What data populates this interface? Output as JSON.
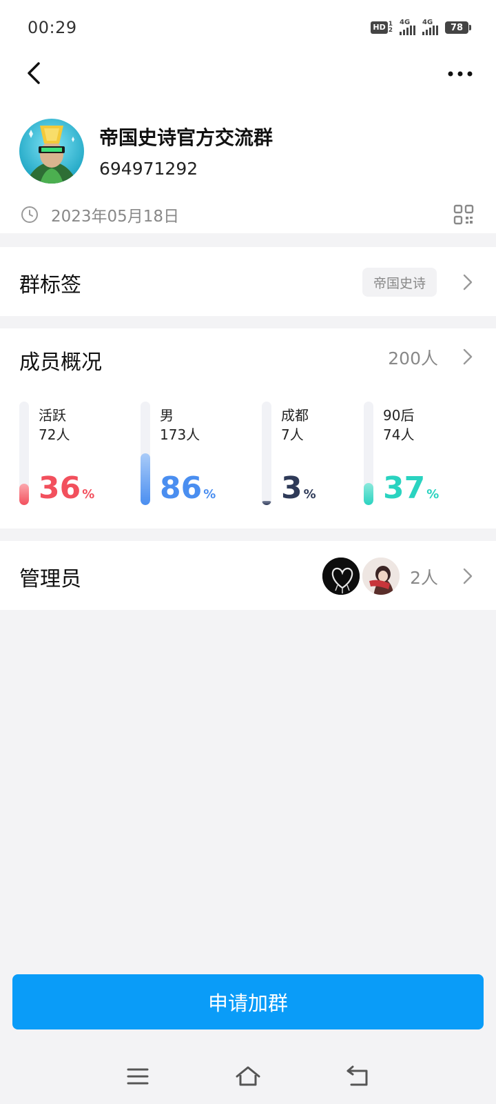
{
  "status_bar": {
    "time": "00:29",
    "hd": "HD",
    "hd_sub_top": "1",
    "hd_sub_bottom": "2",
    "network1": "4G",
    "network2": "4G",
    "battery": "78"
  },
  "header": {
    "back_icon": "chevron-left-icon",
    "more_icon": "more-horizontal-icon"
  },
  "group": {
    "name": "帝国史诗官方交流群",
    "id": "694971292",
    "created_date": "2023年05月18日",
    "clock_icon": "clock-icon",
    "qr_icon": "qr-code-icon"
  },
  "tags_section": {
    "title": "群标签",
    "tag": "帝国史诗"
  },
  "members_section": {
    "title": "成员概况",
    "total": "200人",
    "stats": [
      {
        "label": "活跃",
        "count": "72人",
        "percent": "36",
        "unit": "%",
        "value": 36,
        "color": "#f2505d",
        "color_light": "#fba8ae"
      },
      {
        "label": "男",
        "count": "173人",
        "percent": "86",
        "unit": "%",
        "value": 86,
        "color": "#4a8ef0",
        "color_light": "#a9cbf8"
      },
      {
        "label": "成都",
        "count": "7人",
        "percent": "3",
        "unit": "%",
        "value": 3,
        "color": "#2e3a58",
        "color_light": "#7a839a"
      },
      {
        "label": "90后",
        "count": "74人",
        "percent": "37",
        "unit": "%",
        "value": 37,
        "color": "#2ad3c0",
        "color_light": "#8ae9dc"
      }
    ]
  },
  "admin_section": {
    "title": "管理员",
    "count": "2人"
  },
  "join_button": {
    "label": "申请加群"
  },
  "system_nav": {
    "menu_icon": "menu-icon",
    "home_icon": "home-icon",
    "back_icon": "back-icon"
  }
}
